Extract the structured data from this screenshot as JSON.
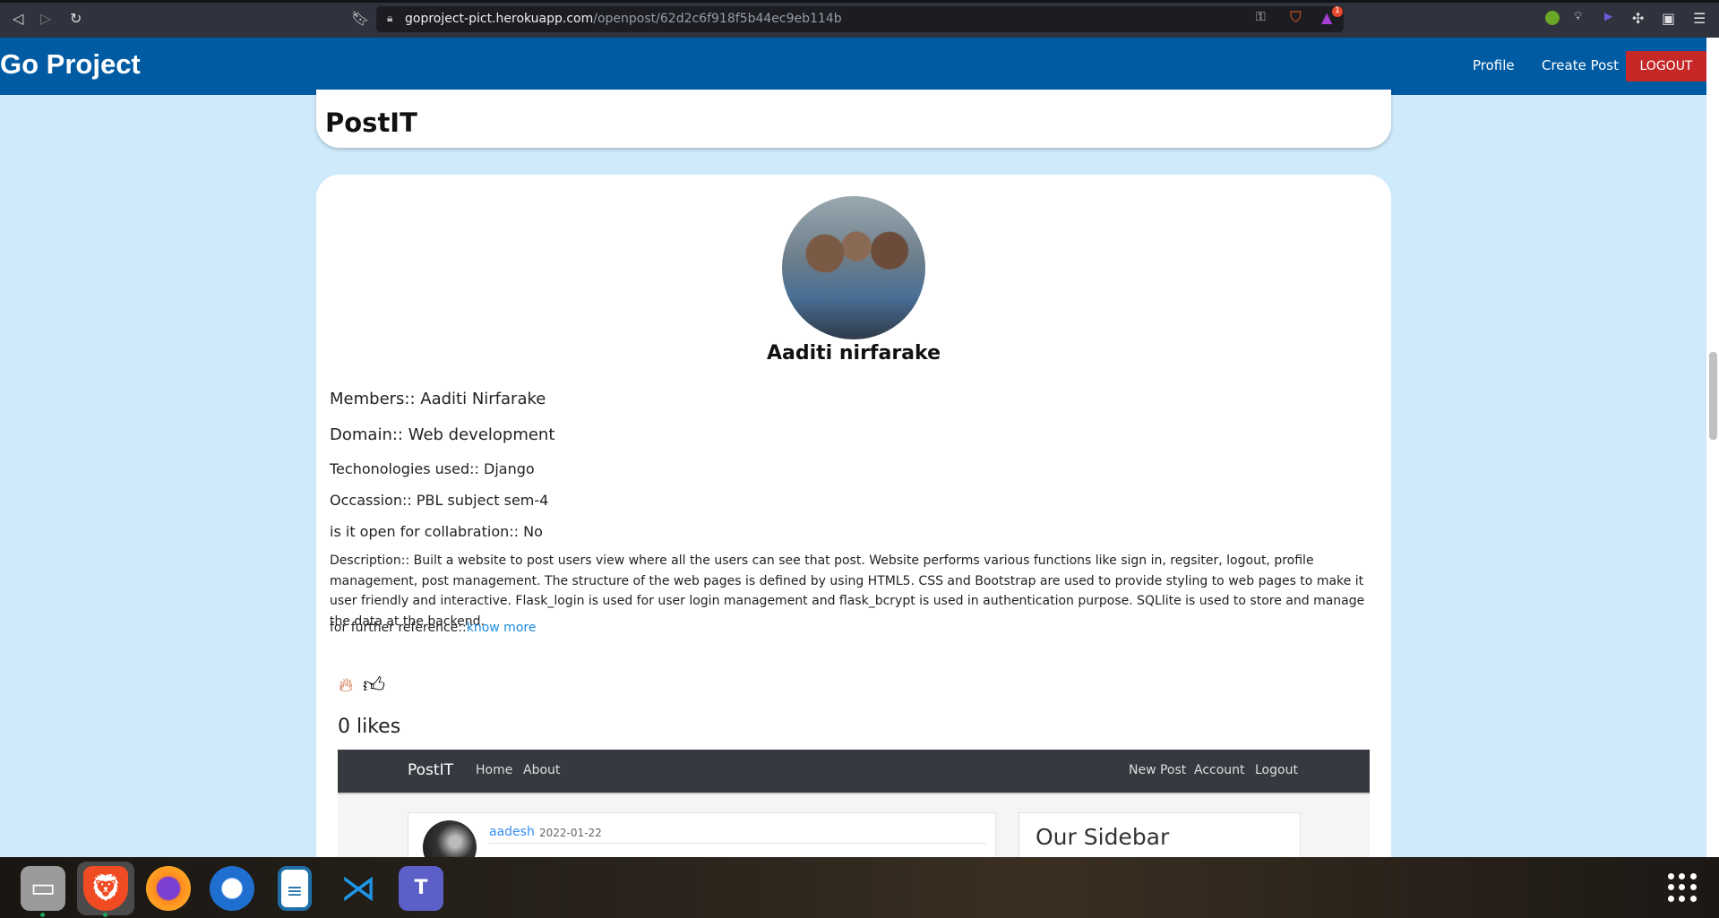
{
  "browser": {
    "url_host": "goproject-pict.herokuapp.com",
    "url_path": "/openpost/62d2c6f918f5b44ec9eb114b",
    "notification_count": "1"
  },
  "nav": {
    "brand": "Go Project",
    "links": [
      "Profile",
      "Create Post"
    ],
    "logout": "LOGOUT",
    "color": "#005ba3",
    "logout_color": "#c62828"
  },
  "page_title": "PostIT",
  "post": {
    "author": "Aaditi nirfarake",
    "members": "Members:: Aaditi Nirfarake",
    "domain": "Domain:: Web development",
    "technologies": "Techonologies used:: Django",
    "occasion": "Occassion:: PBL subject sem-4",
    "open": "is it open for collabration:: No",
    "description": "Description:: Built a website to post users view where all the users can see that post. Website performs various functions like sign in, regsiter, logout, profile management, post management. The structure of the web pages is defined by using HTML5. CSS and Bootstrap are used to provide styling to web pages to make it user friendly and interactive. Flask_login is used for user login management and flask_bcrypt is used in authentication purpose. SQLlite is used to store and manage the data at the backend.",
    "reference_label": "for further reference::",
    "reference_link": "know more",
    "likes": "0 likes"
  },
  "embedded": {
    "brand": "PostIT",
    "left_links": [
      "Home",
      "About"
    ],
    "right_links": [
      "New Post",
      "Account",
      "Logout"
    ],
    "author": "aadesh",
    "date": "2022-01-22",
    "sidebar_title": "Our Sidebar"
  },
  "taskbar": {
    "apps": [
      "files-icon",
      "brave-icon",
      "firefox-icon",
      "thunderbird-icon",
      "writer-icon",
      "vscode-icon",
      "teams-icon"
    ]
  }
}
